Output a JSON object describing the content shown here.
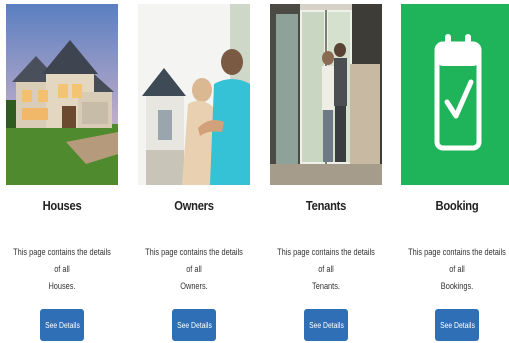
{
  "cards": [
    {
      "title": "Houses",
      "description_line1": "This page contains the details of all",
      "description_line2": "Houses.",
      "button_label": "See Details",
      "image_icon": "house-photo"
    },
    {
      "title": "Owners",
      "description_line1": "This page contains the details of all",
      "description_line2": "Owners.",
      "button_label": "See Details",
      "image_icon": "owners-photo"
    },
    {
      "title": "Tenants",
      "description_line1": "This page contains the details of all",
      "description_line2": "Tenants.",
      "button_label": "See Details",
      "image_icon": "tenants-photo"
    },
    {
      "title": "Booking",
      "description_line1": "This page contains the details of all",
      "description_line2": "Bookings.",
      "button_label": "See Details",
      "image_icon": "calendar-check-icon"
    }
  ],
  "colors": {
    "button_bg": "#2f6fb6",
    "booking_bg": "#1fb45a"
  }
}
